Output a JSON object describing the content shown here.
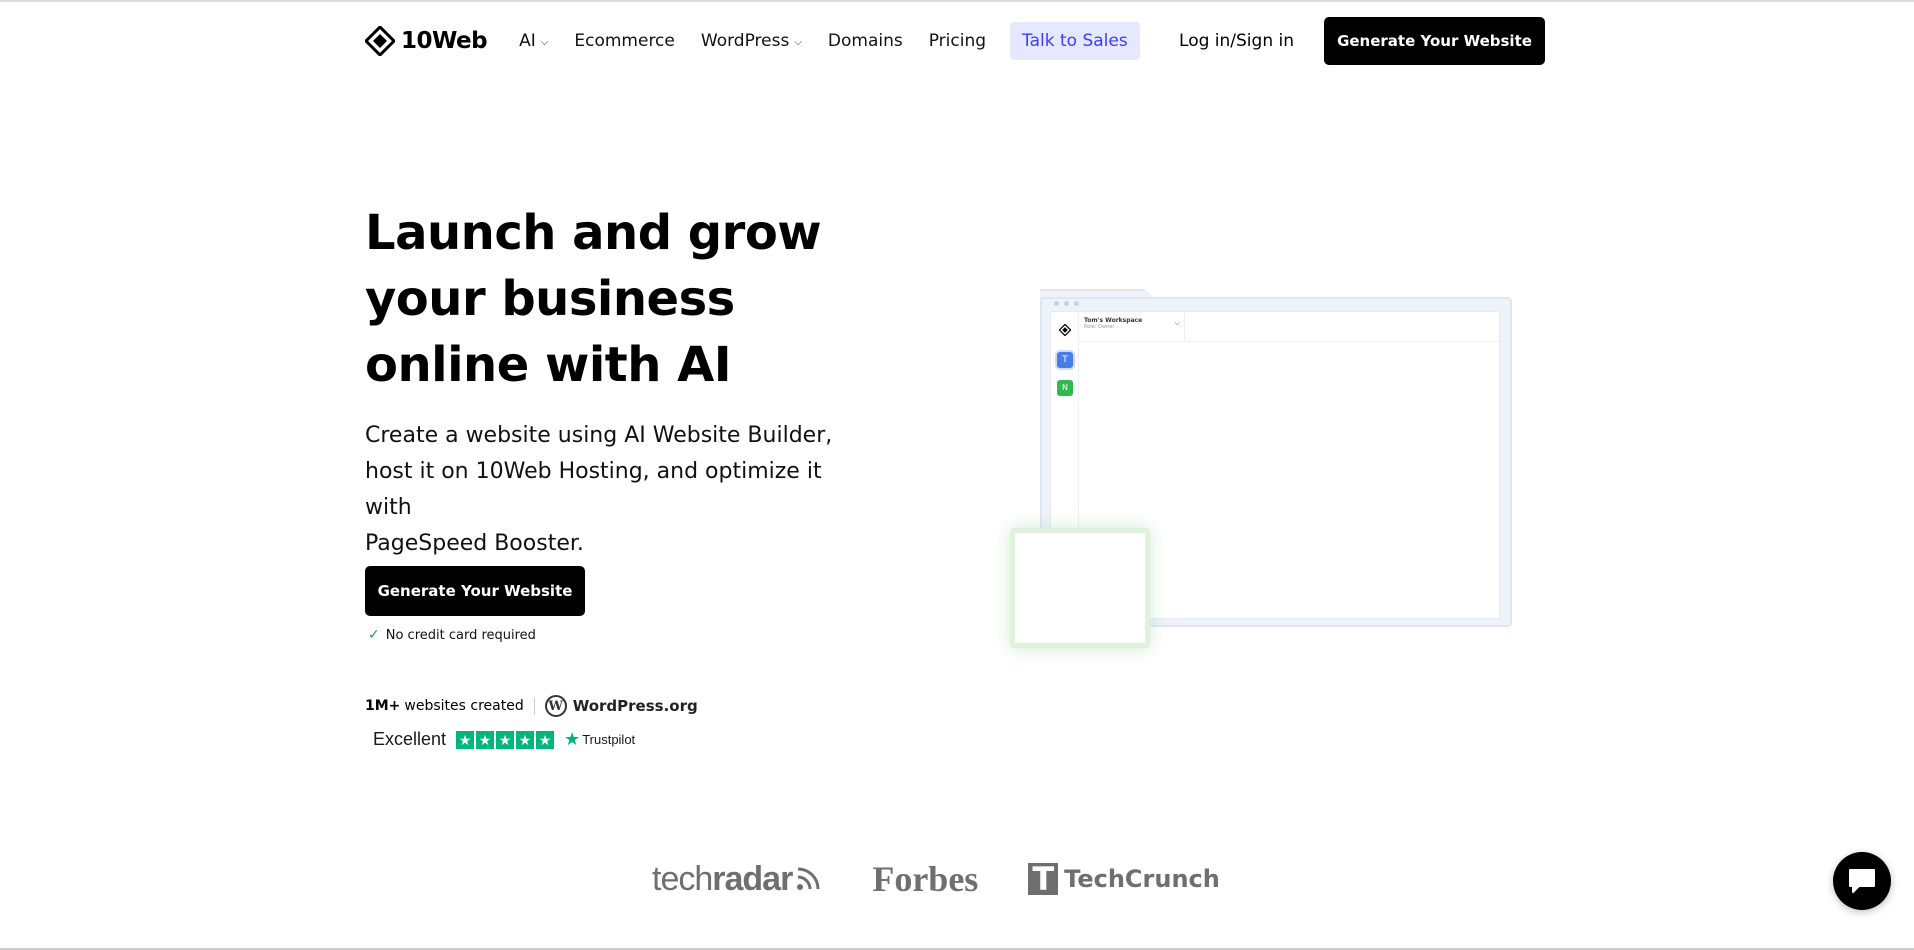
{
  "header": {
    "logo_text": "10Web",
    "nav": [
      {
        "label": "AI",
        "has_dropdown": true
      },
      {
        "label": "Ecommerce",
        "has_dropdown": false
      },
      {
        "label": "WordPress",
        "has_dropdown": true
      },
      {
        "label": "Domains",
        "has_dropdown": false
      },
      {
        "label": "Pricing",
        "has_dropdown": false
      }
    ],
    "talk_to_sales": "Talk to Sales",
    "login": "Log in/Sign in",
    "cta": "Generate Your Website"
  },
  "hero": {
    "title_lines": [
      "Launch and grow",
      "your business",
      "online with AI"
    ],
    "subtitle_lines": [
      "Create a website using AI Website Builder,",
      "host it on 10Web Hosting, and optimize it with",
      "PageSpeed Booster."
    ],
    "cta": "Generate Your Website",
    "note": "No credit card required",
    "stat_value": "1M+",
    "stat_label": "websites created",
    "partner": "WordPress.org",
    "rating_label": "Excellent",
    "rating_stars": 5,
    "rating_brand": "Trustpilot"
  },
  "illustration": {
    "workspace_name": "Tom's Workspace",
    "workspace_role": "Role: Owner",
    "avatar_1": "T",
    "avatar_2": "N"
  },
  "press": {
    "techradar": [
      "tech",
      "radar"
    ],
    "forbes": "Forbes",
    "techcrunch": "TechCrunch"
  },
  "colors": {
    "accent_blue": "#3a3ff2",
    "talk_bg": "#e6e8ff",
    "trustpilot_green": "#00b67a"
  }
}
